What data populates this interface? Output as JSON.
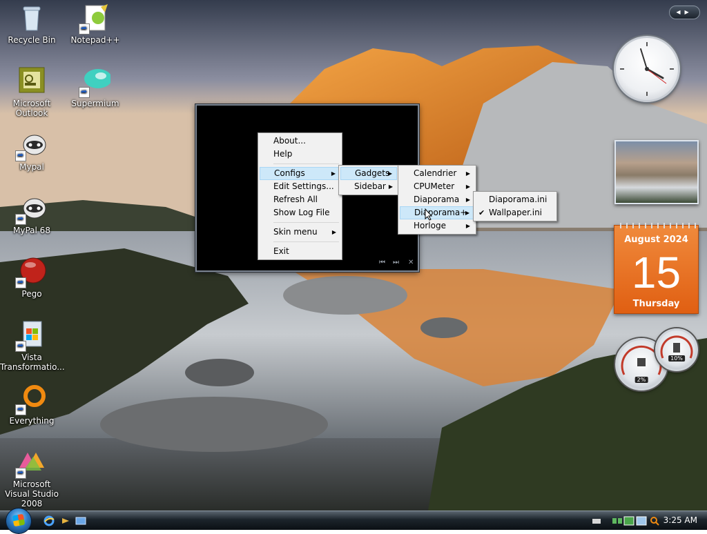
{
  "desktop": {
    "icons": [
      {
        "label": "Recycle Bin",
        "icon": "recycle-bin-icon",
        "shortcut": false
      },
      {
        "label": "Notepad++",
        "icon": "notepadpp-icon",
        "shortcut": true
      },
      {
        "label": "Microsoft Outlook",
        "icon": "outlook-icon",
        "shortcut": false
      },
      {
        "label": "Supermium",
        "icon": "supermium-icon",
        "shortcut": true
      },
      {
        "label": "Mypal",
        "icon": "mypal-icon",
        "shortcut": true
      },
      {
        "label": "MyPal 68",
        "icon": "mypal68-icon",
        "shortcut": true
      },
      {
        "label": "Pego",
        "icon": "pego-icon",
        "shortcut": true
      },
      {
        "label": "Vista Transformatio...",
        "icon": "vista-transformation-icon",
        "shortcut": true
      },
      {
        "label": "Everything",
        "icon": "everything-icon",
        "shortcut": true
      },
      {
        "label": "Microsoft Visual Studio 2008",
        "icon": "visual-studio-icon",
        "shortcut": true
      }
    ]
  },
  "context_menu": {
    "items": [
      "About...",
      "Help",
      "Configs",
      "Edit Settings...",
      "Refresh All",
      "Show Log File",
      "Skin menu",
      "Exit"
    ]
  },
  "configs_menu": {
    "items": [
      "Gadgets",
      "Sidebar"
    ]
  },
  "gadgets_menu": {
    "items": [
      "Calendrier",
      "CPUMeter",
      "Diaporama",
      "Diaporama+",
      "Horloge"
    ]
  },
  "diaporama_plus_menu": {
    "items": [
      "Diaporama.ini",
      "Wallpaper.ini"
    ],
    "checked": "Wallpaper.ini"
  },
  "calendar": {
    "month_year": "August 2024",
    "day": "15",
    "weekday": "Thursday"
  },
  "cpu_meter": {
    "cpu": "2%",
    "memory": "10%"
  },
  "taskbar": {
    "time": "3:25 AM"
  },
  "colors": {
    "calendar_accent": "#e5661a",
    "menu_highlight": "#cde8f9"
  }
}
